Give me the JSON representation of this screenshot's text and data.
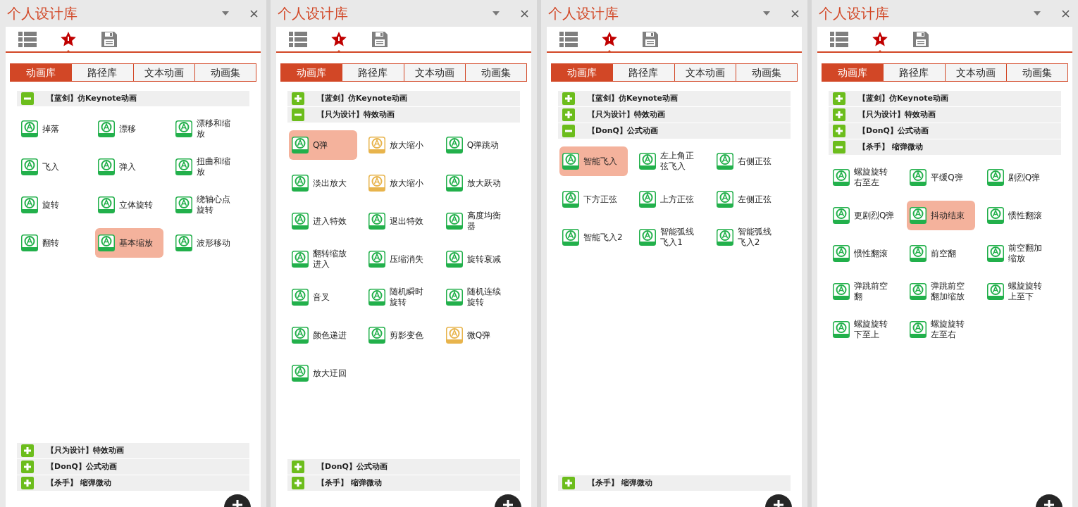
{
  "panels": [
    {
      "title": "个人设计库",
      "icon_tabs": [
        {
          "kind": "list",
          "selected": false
        },
        {
          "kind": "star",
          "selected": true
        },
        {
          "kind": "save",
          "selected": false
        }
      ],
      "tabs": [
        {
          "label": "动画库",
          "selected": true
        },
        {
          "label": "路径库",
          "selected": false
        },
        {
          "label": "文本动画",
          "selected": false
        },
        {
          "label": "动画集",
          "selected": false
        }
      ],
      "groups": [
        {
          "label": "【蓝剑】仿Keynote动画",
          "expanded": true,
          "items": [
            {
              "label": "掉落",
              "kind": "entrance",
              "selected": false
            },
            {
              "label": "漂移",
              "kind": "entrance",
              "selected": false
            },
            {
              "label": "漂移和缩放",
              "kind": "entrance",
              "selected": false
            },
            {
              "label": "飞入",
              "kind": "entrance",
              "selected": false
            },
            {
              "label": "弹入",
              "kind": "entrance",
              "selected": false
            },
            {
              "label": "扭曲和缩放",
              "kind": "entrance",
              "selected": false
            },
            {
              "label": "旋转",
              "kind": "entrance",
              "selected": false
            },
            {
              "label": "立体旋转",
              "kind": "entrance",
              "selected": false
            },
            {
              "label": "绕轴心点旋转",
              "kind": "entrance",
              "selected": false
            },
            {
              "label": "翻转",
              "kind": "entrance",
              "selected": false
            },
            {
              "label": "基本缩放",
              "kind": "entrance",
              "selected": true
            },
            {
              "label": "波形移动",
              "kind": "entrance",
              "selected": false
            }
          ]
        },
        {
          "label": "【只为设计】特效动画",
          "expanded": false
        },
        {
          "label": "【DonQ】公式动画",
          "expanded": false
        },
        {
          "label": "【杀手】 缩弹微动",
          "expanded": false
        }
      ]
    },
    {
      "title": "个人设计库",
      "icon_tabs": [
        {
          "kind": "list",
          "selected": false
        },
        {
          "kind": "star",
          "selected": true
        },
        {
          "kind": "save",
          "selected": false
        }
      ],
      "tabs": [
        {
          "label": "动画库",
          "selected": true
        },
        {
          "label": "路径库",
          "selected": false
        },
        {
          "label": "文本动画",
          "selected": false
        },
        {
          "label": "动画集",
          "selected": false
        }
      ],
      "groups": [
        {
          "label": "【蓝剑】仿Keynote动画",
          "expanded": false
        },
        {
          "label": "【只为设计】特效动画",
          "expanded": true,
          "items": [
            {
              "label": "Q弹",
              "kind": "entrance",
              "selected": true
            },
            {
              "label": "放大缩小",
              "kind": "exit",
              "selected": false
            },
            {
              "label": "Q弹跳动",
              "kind": "entrance",
              "selected": false
            },
            {
              "label": "淡出放大",
              "kind": "entrance",
              "selected": false
            },
            {
              "label": "放大缩小",
              "kind": "exit",
              "selected": false
            },
            {
              "label": "放大跃动",
              "kind": "entrance",
              "selected": false
            },
            {
              "label": "进入特效",
              "kind": "entrance",
              "selected": false
            },
            {
              "label": "退出特效",
              "kind": "entrance",
              "selected": false
            },
            {
              "label": "高度均衡器",
              "kind": "entrance",
              "selected": false
            },
            {
              "label": "翻转缩放进入",
              "kind": "entrance",
              "selected": false
            },
            {
              "label": "压缩消失",
              "kind": "entrance",
              "selected": false
            },
            {
              "label": "旋转衰减",
              "kind": "entrance",
              "selected": false
            },
            {
              "label": "音叉",
              "kind": "entrance",
              "selected": false
            },
            {
              "label": "随机瞬时旋转",
              "kind": "entrance",
              "selected": false
            },
            {
              "label": "随机连续旋转",
              "kind": "entrance",
              "selected": false
            },
            {
              "label": "颜色递进",
              "kind": "entrance",
              "selected": false
            },
            {
              "label": "剪影变色",
              "kind": "entrance",
              "selected": false
            },
            {
              "label": "微Q弹",
              "kind": "exit",
              "selected": false
            },
            {
              "label": "放大迂回",
              "kind": "entrance",
              "selected": false
            }
          ]
        },
        {
          "label": "【DonQ】公式动画",
          "expanded": false
        },
        {
          "label": "【杀手】 缩弹微动",
          "expanded": false
        }
      ]
    },
    {
      "title": "个人设计库",
      "icon_tabs": [
        {
          "kind": "list",
          "selected": false
        },
        {
          "kind": "star",
          "selected": true
        },
        {
          "kind": "save",
          "selected": false
        }
      ],
      "tabs": [
        {
          "label": "动画库",
          "selected": true
        },
        {
          "label": "路径库",
          "selected": false
        },
        {
          "label": "文本动画",
          "selected": false
        },
        {
          "label": "动画集",
          "selected": false
        }
      ],
      "groups": [
        {
          "label": "【蓝剑】仿Keynote动画",
          "expanded": false
        },
        {
          "label": "【只为设计】特效动画",
          "expanded": false
        },
        {
          "label": "【DonQ】公式动画",
          "expanded": true,
          "items": [
            {
              "label": "智能飞入",
              "kind": "entrance",
              "selected": true
            },
            {
              "label": "左上角正弦飞入",
              "kind": "entrance",
              "selected": false
            },
            {
              "label": "右侧正弦",
              "kind": "entrance",
              "selected": false
            },
            {
              "label": "下方正弦",
              "kind": "entrance",
              "selected": false
            },
            {
              "label": "上方正弦",
              "kind": "entrance",
              "selected": false
            },
            {
              "label": "左侧正弦",
              "kind": "entrance",
              "selected": false
            },
            {
              "label": "智能飞入2",
              "kind": "entrance",
              "selected": false
            },
            {
              "label": "智能弧线飞入1",
              "kind": "entrance",
              "selected": false
            },
            {
              "label": "智能弧线飞入2",
              "kind": "entrance",
              "selected": false
            }
          ]
        },
        {
          "label": "【杀手】 缩弹微动",
          "expanded": false
        }
      ]
    },
    {
      "title": "个人设计库",
      "icon_tabs": [
        {
          "kind": "list",
          "selected": false
        },
        {
          "kind": "star",
          "selected": true
        },
        {
          "kind": "save",
          "selected": false
        }
      ],
      "tabs": [
        {
          "label": "动画库",
          "selected": true
        },
        {
          "label": "路径库",
          "selected": false
        },
        {
          "label": "文本动画",
          "selected": false
        },
        {
          "label": "动画集",
          "selected": false
        }
      ],
      "groups": [
        {
          "label": "【蓝剑】仿Keynote动画",
          "expanded": false
        },
        {
          "label": "【只为设计】特效动画",
          "expanded": false
        },
        {
          "label": "【DonQ】公式动画",
          "expanded": false
        },
        {
          "label": "【杀手】 缩弹微动",
          "expanded": true,
          "items": [
            {
              "label": "螺旋旋转右至左",
              "kind": "entrance",
              "selected": false
            },
            {
              "label": "平缓Q弹",
              "kind": "entrance",
              "selected": false
            },
            {
              "label": "剧烈Q弹",
              "kind": "entrance",
              "selected": false
            },
            {
              "label": "更剧烈Q弹",
              "kind": "entrance",
              "selected": false
            },
            {
              "label": "抖动结束",
              "kind": "entrance",
              "selected": true
            },
            {
              "label": "惯性翻滚",
              "kind": "entrance",
              "selected": false
            },
            {
              "label": "惯性翻滚",
              "kind": "entrance",
              "selected": false
            },
            {
              "label": "前空翻",
              "kind": "entrance",
              "selected": false
            },
            {
              "label": "前空翻加缩放",
              "kind": "entrance",
              "selected": false
            },
            {
              "label": "弹跳前空翻",
              "kind": "entrance",
              "selected": false
            },
            {
              "label": "弹跳前空翻加缩放",
              "kind": "entrance",
              "selected": false
            },
            {
              "label": "螺旋旋转上至下",
              "kind": "entrance",
              "selected": false
            },
            {
              "label": "螺旋旋转下至上",
              "kind": "entrance",
              "selected": false
            },
            {
              "label": "螺旋旋转左至右",
              "kind": "entrance",
              "selected": false
            }
          ]
        }
      ]
    }
  ]
}
